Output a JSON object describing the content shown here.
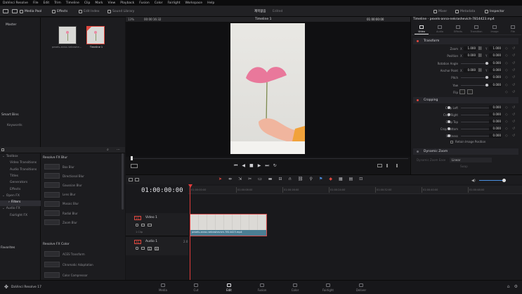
{
  "menu": [
    "DaVinci Resolve",
    "File",
    "Edit",
    "Trim",
    "Timeline",
    "Clip",
    "Mark",
    "View",
    "Playback",
    "Fusion",
    "Color",
    "Fairlight",
    "Workspace",
    "Help"
  ],
  "toolbar": {
    "media_pool": "Media Pool",
    "effects": "Effects",
    "edit_index": "Edit Index",
    "sound_library": "Sound Library",
    "project_name": "제목없음",
    "project_status": "Edited",
    "mixer": "Mixer",
    "metadata": "Metadata",
    "inspector": "Inspector"
  },
  "media_pool": {
    "bin_master": "Master",
    "clips": [
      {
        "name": "pexels-anna-nekrashe..."
      },
      {
        "name": "Timeline 1"
      }
    ],
    "smart_bins": "Smart Bins",
    "keywords": "Keywords"
  },
  "viewer": {
    "zoom": "13%",
    "timecode": "00:00:16:32",
    "timeline_name": "Timeline 1",
    "right_timecode": "01:00:00:00"
  },
  "effects": {
    "tree": [
      {
        "label": "Toolbox",
        "expanded": true
      },
      {
        "label": "Video Transitions"
      },
      {
        "label": "Audio Transitions"
      },
      {
        "label": "Titles"
      },
      {
        "label": "Generators"
      },
      {
        "label": "Effects"
      },
      {
        "label": "Open FX",
        "expanded": true
      },
      {
        "label": "Filters",
        "selected": true
      },
      {
        "label": "Audio FX",
        "expanded": true
      },
      {
        "label": "Fairlight FX"
      }
    ],
    "favorites": "Favorites",
    "blur_group": "Resolve FX Blur",
    "blur_items": [
      "Box Blur",
      "Directional Blur",
      "Gaussian Blur",
      "Lens Blur",
      "Mosaic Blur",
      "Radial Blur",
      "Zoom Blur"
    ],
    "color_group": "Resolve FX Color",
    "color_items": [
      "ACES Transform",
      "Chromatic Adaptation",
      "Color Compressor"
    ]
  },
  "inspector": {
    "title": "Timeline - pexels-anna-nekrashevich-7814423.mp4",
    "tabs": [
      "Video",
      "Audio",
      "Effects",
      "Transition",
      "Image",
      "File"
    ],
    "transform_label": "Transform",
    "transform_rows": [
      {
        "label": "Zoom",
        "x_label": "X",
        "x": "1.000",
        "y_label": "Y",
        "y": "1.000"
      },
      {
        "label": "Position",
        "x_label": "X",
        "x": "0.000",
        "y_label": "Y",
        "y": "0.000"
      },
      {
        "label": "Rotation Angle",
        "y": "0.000"
      },
      {
        "label": "Anchor Point",
        "x_label": "X",
        "x": "0.000",
        "y_label": "Y",
        "y": "0.000"
      },
      {
        "label": "Pitch",
        "y": "0.000"
      },
      {
        "label": "Yaw",
        "y": "0.000"
      },
      {
        "label": "Flip"
      }
    ],
    "cropping_label": "Cropping",
    "cropping_rows": [
      {
        "label": "Crop Left",
        "y": "0.000"
      },
      {
        "label": "Crop Right",
        "y": "0.000"
      },
      {
        "label": "Crop Top",
        "y": "0.000"
      },
      {
        "label": "Crop Bottom",
        "y": "0.000"
      },
      {
        "label": "Softness",
        "y": "0.000"
      }
    ],
    "retain_image_position": "Retain Image Position",
    "dynamic_zoom_label": "Dynamic Zoom",
    "dynamic_zoom_ease_label": "Dynamic Zoom Ease",
    "dynamic_zoom_ease_value": "Linear",
    "swap": "Swap"
  },
  "timeline": {
    "timecode": "01:00:00:00",
    "ruler": [
      "01:00:00:00",
      "01:00:08:00",
      "01:00:16:00",
      "01:00:24:00",
      "01:00:32:00",
      "01:00:40:00",
      "01:00:48:00"
    ],
    "video_track": {
      "id": "V1",
      "name": "Video 1",
      "clip_count": "1 Clip"
    },
    "audio_track": {
      "id": "A1",
      "name": "Audio 1",
      "channel": "2.0",
      "solo": "S",
      "mute": "M"
    },
    "clip_name": "pexels-anna-nekrashevich-7814423.mp4"
  },
  "pages": [
    "Media",
    "Cut",
    "Edit",
    "Fusion",
    "Color",
    "Fairlight",
    "Deliver"
  ],
  "active_page": "Edit",
  "app_label": "DaVinci Resolve 17",
  "colors": {
    "accent": "#e0483f",
    "clip": "#4b7e93",
    "clip_border": "#d55050",
    "playhead": "#e03b3b"
  }
}
